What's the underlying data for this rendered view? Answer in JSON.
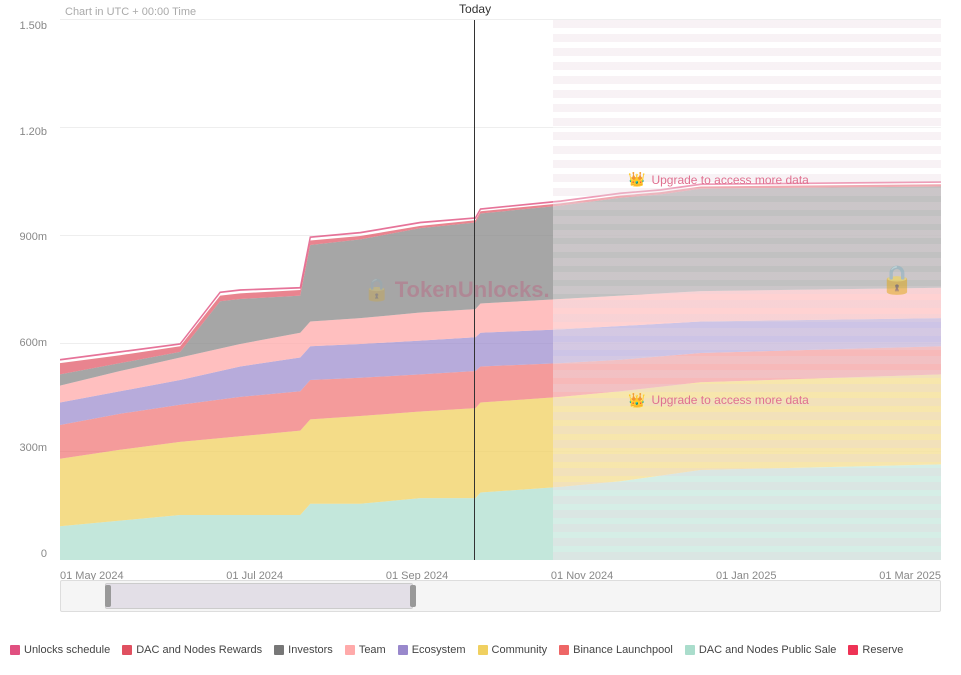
{
  "chart": {
    "title": "Chart in UTC + 00:00 Time",
    "today_label": "Today",
    "y_axis": [
      "0",
      "300m",
      "600m",
      "900m",
      "1.20b",
      "1.50b"
    ],
    "x_axis": [
      "01 May 2024",
      "01 Jul 2024",
      "01 Sep 2024",
      "01 Nov 2024",
      "01 Jan 2025",
      "01 Mar 2025"
    ],
    "upgrade_message_1": "Upgrade to access more data",
    "upgrade_message_2": "Upgrade to access more data",
    "watermark_text": "TokenUnlocks."
  },
  "legend": {
    "items": [
      {
        "label": "Unlocks schedule",
        "color": "#e05080"
      },
      {
        "label": "DAC and Nodes Rewards",
        "color": "#e05060"
      },
      {
        "label": "Investors",
        "color": "#777777"
      },
      {
        "label": "Team",
        "color": "#ffaaaa"
      },
      {
        "label": "Ecosystem",
        "color": "#9988cc"
      },
      {
        "label": "Community",
        "color": "#f0d060"
      },
      {
        "label": "Binance Launchpool",
        "color": "#ee6666"
      },
      {
        "label": "DAC and Nodes Public Sale",
        "color": "#aaddcc"
      },
      {
        "label": "Reserve",
        "color": "#ee3355"
      }
    ]
  }
}
